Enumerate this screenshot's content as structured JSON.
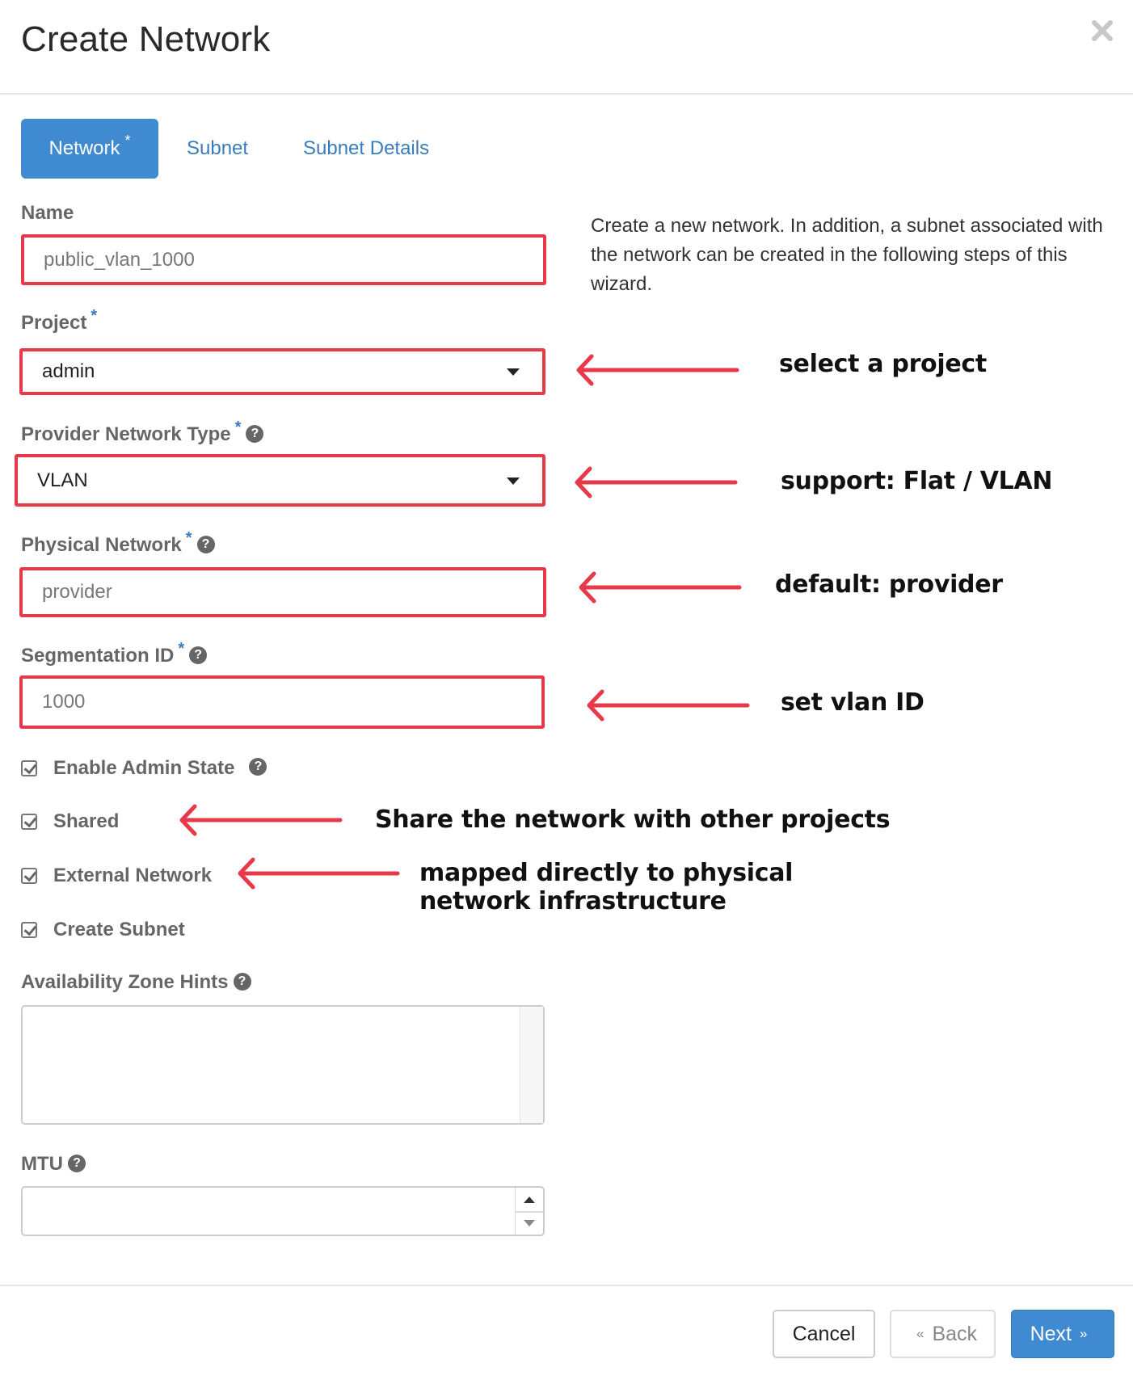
{
  "dialog": {
    "title": "Create Network",
    "close_icon": "close-icon"
  },
  "tabs": [
    {
      "label": "Network",
      "required_mark": "*",
      "active": true
    },
    {
      "label": "Subnet",
      "active": false
    },
    {
      "label": "Subnet Details",
      "active": false
    }
  ],
  "description": "Create a new network. In addition, a subnet associated with the network can be created in the following steps of this wizard.",
  "form": {
    "name": {
      "label": "Name",
      "value": "public_vlan_1000"
    },
    "project": {
      "label": "Project",
      "required_mark": "*",
      "selected": "admin"
    },
    "provider_network_type": {
      "label": "Provider Network Type",
      "required_mark": "*",
      "selected": "VLAN",
      "help_icon": "question-circle-icon"
    },
    "physical_network": {
      "label": "Physical Network",
      "required_mark": "*",
      "value": "provider",
      "help_icon": "question-circle-icon"
    },
    "segmentation_id": {
      "label": "Segmentation ID",
      "required_mark": "*",
      "value": "1000",
      "help_icon": "question-circle-icon"
    },
    "checkboxes": [
      {
        "label": "Enable Admin State",
        "checked": true,
        "help_icon": "question-circle-icon"
      },
      {
        "label": "Shared",
        "checked": true
      },
      {
        "label": "External Network",
        "checked": true
      },
      {
        "label": "Create Subnet",
        "checked": true
      }
    ],
    "availability_zone_hints": {
      "label": "Availability Zone Hints",
      "help_icon": "question-circle-icon",
      "options": []
    },
    "mtu": {
      "label": "MTU",
      "value": "",
      "help_icon": "question-circle-icon"
    }
  },
  "annotations": {
    "project": "select a project",
    "provider_network_type": "support: Flat / VLAN",
    "physical_network": "default: provider",
    "segmentation_id": "set vlan ID",
    "shared": "Share the network with other projects",
    "external_line1": "mapped directly to physical",
    "external_line2": "network infrastructure",
    "color": "#e8394a"
  },
  "footer": {
    "cancel_label": "Cancel",
    "back_label": "Back",
    "back_glyph": "«",
    "next_label": "Next",
    "next_glyph": "»"
  },
  "colors": {
    "primary": "#3f8ad0",
    "link": "#3a7bbf",
    "highlight_border": "#e8394a"
  }
}
